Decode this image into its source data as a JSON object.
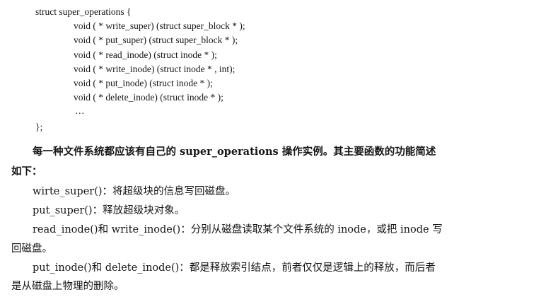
{
  "code": {
    "open": "struct super_operations {",
    "members": [
      "void ( * write_super) (struct super_block * );",
      "void ( * put_super) (struct super_block * );",
      "void ( * read_inode) (struct inode * );",
      "void ( * write_inode) (struct inode * , int);",
      "void ( * put_inode) (struct inode * );",
      "void ( * delete_inode) (struct inode * );"
    ],
    "ellipsis": "…",
    "close": "};"
  },
  "intro": {
    "line1": "每一种文件系统都应该有自己的 super_operations 操作实例。其主要函数的功能简述",
    "line2": "如下："
  },
  "items": {
    "write_super": "wirte_super()：将超级块的信息写回磁盘。",
    "put_super": "put_super()：释放超级块对象。",
    "read_write_1": "read_inode()和 write_inode()：分别从磁盘读取某个文件系统的 inode，或把 inode 写",
    "read_write_2": "回磁盘。",
    "put_delete_1": "put_inode()和 delete_inode()：都是释放索引结点，前者仅仅是逻辑上的释放，而后者",
    "put_delete_2": "是从磁盘上物理的删除。"
  }
}
